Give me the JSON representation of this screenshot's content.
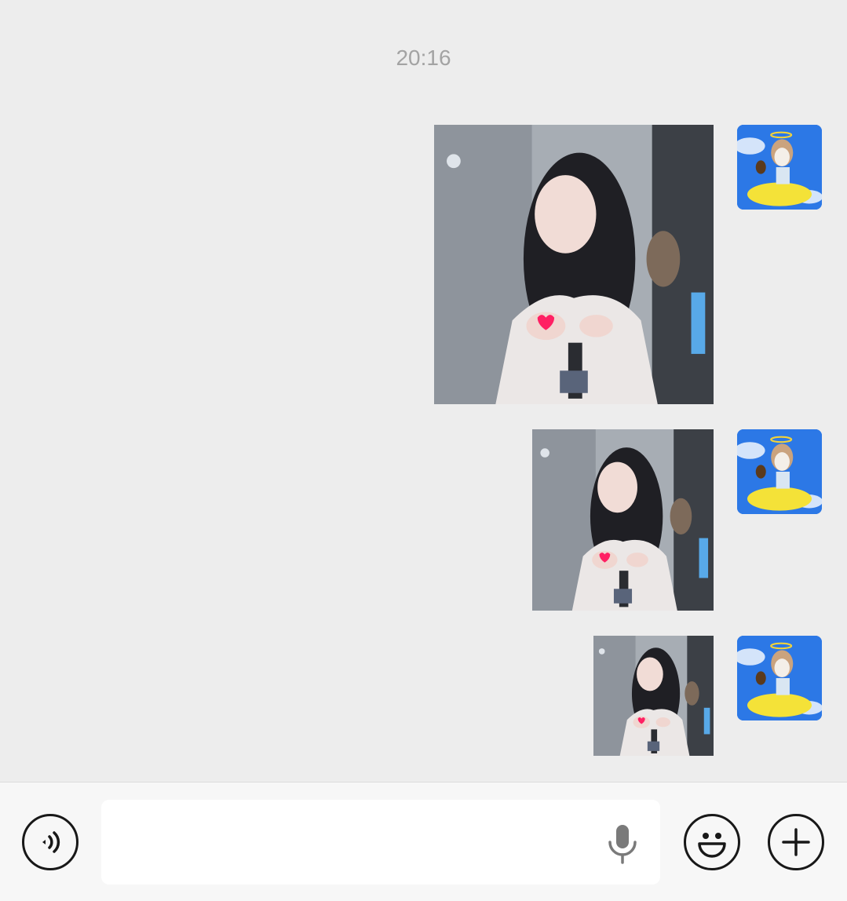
{
  "chat": {
    "timestamp": "20:16",
    "messages": [
      {
        "type": "image",
        "sender": "self",
        "content": "photo-girl-heart-gesture"
      },
      {
        "type": "image",
        "sender": "self",
        "content": "photo-girl-heart-gesture"
      },
      {
        "type": "image",
        "sender": "self",
        "content": "photo-girl-heart-gesture"
      }
    ]
  },
  "input_bar": {
    "voice_toggle_icon": "voice-wave-icon",
    "text_value": "",
    "mic_icon": "microphone-icon",
    "emoji_icon": "smiley-face-icon",
    "more_icon": "plus-icon"
  },
  "colors": {
    "background": "#ededed",
    "bottom_bar": "#f7f7f7",
    "avatar_sky": "#2c78e6",
    "timestamp": "#a3a3a3"
  }
}
